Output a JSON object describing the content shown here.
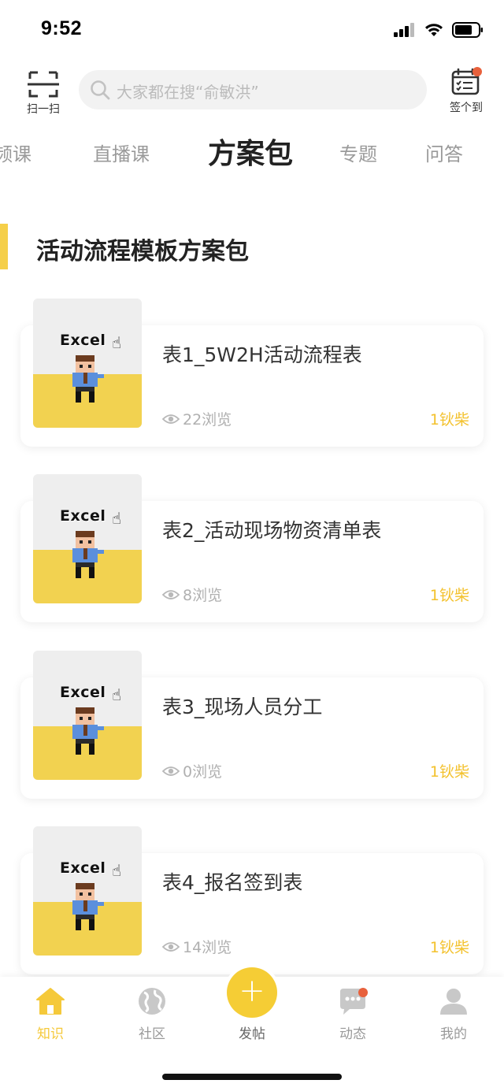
{
  "status": {
    "time": "9:52"
  },
  "header": {
    "scan_label": "扫一扫",
    "search_placeholder": "大家都在搜“俞敏洪”",
    "checkin_label": "签个到"
  },
  "tabs": [
    {
      "label": "频课",
      "active": false
    },
    {
      "label": "直播课",
      "active": false
    },
    {
      "label": "方案包",
      "active": true
    },
    {
      "label": "专题",
      "active": false
    },
    {
      "label": "问答",
      "active": false
    }
  ],
  "section": {
    "title": "活动流程模板方案包"
  },
  "items": [
    {
      "title": "表1_5W2H活动流程表",
      "views": "22浏览",
      "price": "1钬柴",
      "thumb_label": "Excel"
    },
    {
      "title": "表2_活动现场物资清单表",
      "views": "8浏览",
      "price": "1钬柴",
      "thumb_label": "Excel"
    },
    {
      "title": "表3_现场人员分工",
      "views": "0浏览",
      "price": "1钬柴",
      "thumb_label": "Excel"
    },
    {
      "title": "表4_报名签到表",
      "views": "14浏览",
      "price": "1钬柴",
      "thumb_label": "Excel"
    }
  ],
  "bottom_nav": {
    "home": "知识",
    "community": "社区",
    "post": "发帖",
    "activity": "动态",
    "mine": "我的"
  },
  "colors": {
    "accent": "#f5cd35",
    "price": "#f3c12c",
    "badge": "#e8613c",
    "thumb_yellow": "#f2d250"
  }
}
